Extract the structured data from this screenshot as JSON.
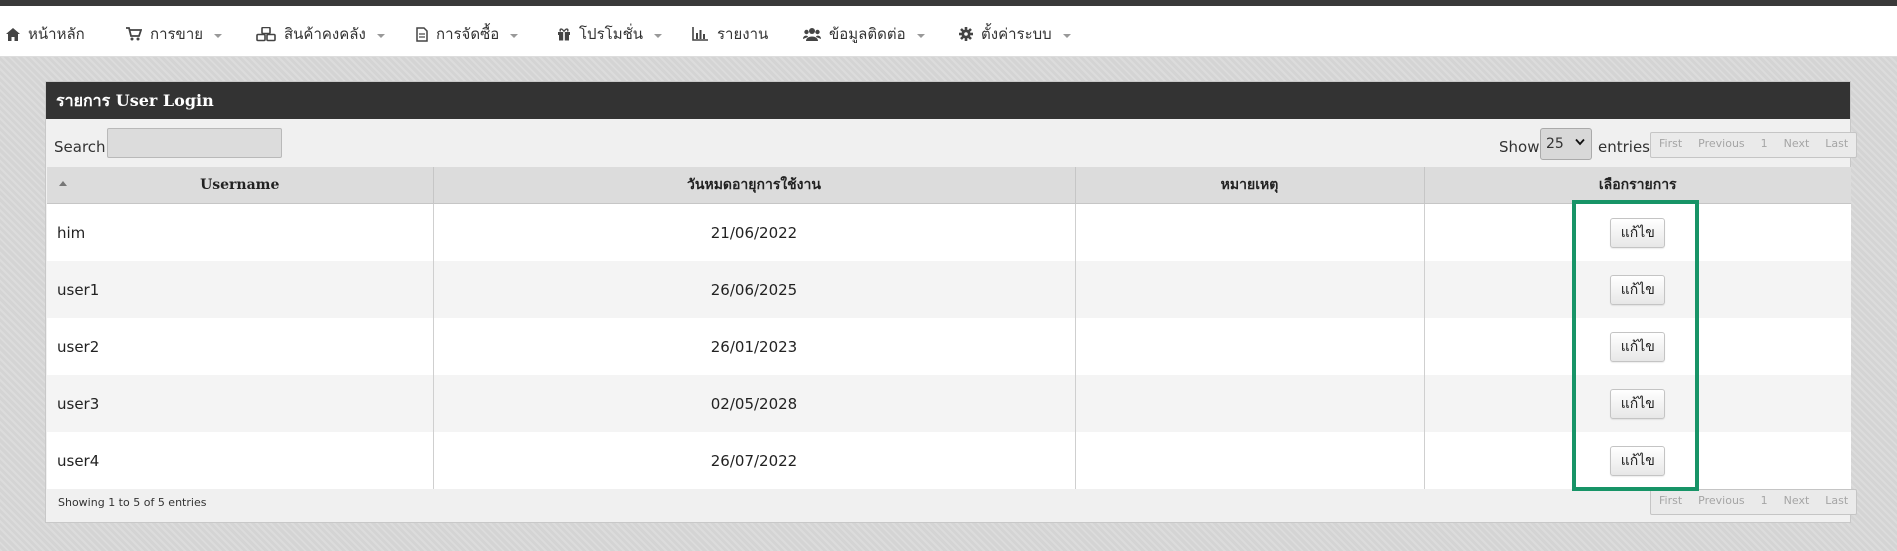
{
  "nav": {
    "items": [
      {
        "label": "หน้าหลัก",
        "icon": "home-icon",
        "dropdown": false
      },
      {
        "label": "การขาย",
        "icon": "cart-icon",
        "dropdown": true
      },
      {
        "label": "สินค้าคงคลัง",
        "icon": "cubes-icon",
        "dropdown": true
      },
      {
        "label": "การจัดซื้อ",
        "icon": "document-icon",
        "dropdown": true
      },
      {
        "label": "โปรโมชั่น",
        "icon": "gift-icon",
        "dropdown": true
      },
      {
        "label": "รายงาน",
        "icon": "bar-chart-icon",
        "dropdown": false
      },
      {
        "label": "ข้อมูลติดต่อ",
        "icon": "users-icon",
        "dropdown": true
      },
      {
        "label": "ตั้งค่าระบบ",
        "icon": "gear-icon",
        "dropdown": true
      }
    ]
  },
  "panel": {
    "title": "รายการ User Login"
  },
  "controls": {
    "search_label": "Search:",
    "search_value": "",
    "show_label": "Show",
    "page_length": "25",
    "entries_label": "entries"
  },
  "pager": {
    "first": "First",
    "previous": "Previous",
    "page": "1",
    "next": "Next",
    "last": "Last"
  },
  "table": {
    "columns": [
      "Username",
      "วันหมดอายุการใช้งาน",
      "หมายเหตุ",
      "เลือกรายการ"
    ],
    "rows": [
      {
        "username": "him",
        "expiry": "21/06/2022",
        "note": "",
        "action": "แก้ไข"
      },
      {
        "username": "user1",
        "expiry": "26/06/2025",
        "note": "",
        "action": "แก้ไข"
      },
      {
        "username": "user2",
        "expiry": "26/01/2023",
        "note": "",
        "action": "แก้ไข"
      },
      {
        "username": "user3",
        "expiry": "02/05/2028",
        "note": "",
        "action": "แก้ไข"
      },
      {
        "username": "user4",
        "expiry": "26/07/2022",
        "note": "",
        "action": "แก้ไข"
      }
    ]
  },
  "footer": {
    "info": "Showing 1 to 5 of 5 entries"
  },
  "colors": {
    "highlight_border": "#179467",
    "panel_header_bg": "#333333"
  }
}
